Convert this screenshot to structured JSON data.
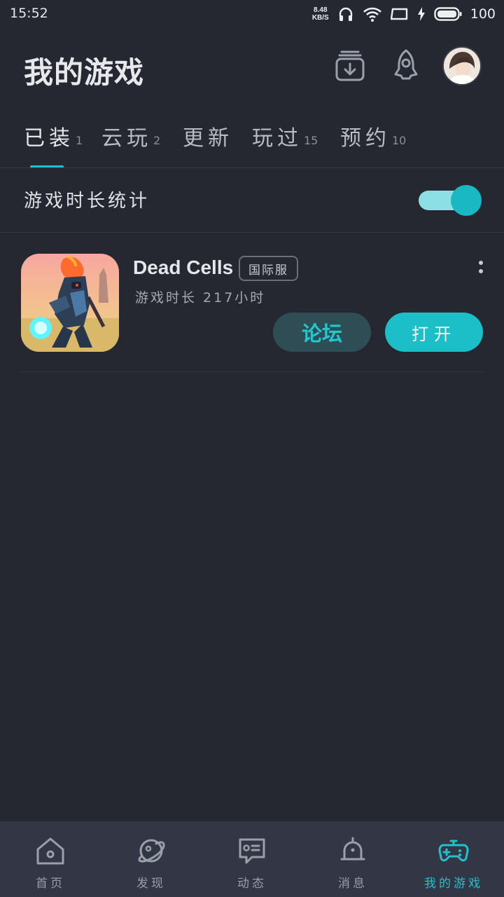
{
  "status_bar": {
    "time": "15:52",
    "net_speed_value": "8.48",
    "net_speed_unit": "KB/S",
    "battery_percent": "100",
    "icons": [
      "headphones-icon",
      "wifi-icon",
      "screen-icon",
      "charging-icon",
      "battery-icon"
    ]
  },
  "header": {
    "title": "我的游戏",
    "icons": [
      "download-icon",
      "rocket-icon",
      "avatar"
    ]
  },
  "tabs": [
    {
      "label": "已装",
      "count": "1",
      "active": true
    },
    {
      "label": "云玩",
      "count": "2",
      "active": false
    },
    {
      "label": "更新",
      "count": "",
      "active": false
    },
    {
      "label": "玩过",
      "count": "15",
      "active": false
    },
    {
      "label": "预约",
      "count": "10",
      "active": false
    }
  ],
  "stats": {
    "label": "游戏时长统计",
    "enabled": true
  },
  "games": [
    {
      "name": "Dead Cells",
      "server_badge": "国际服",
      "play_time": "游戏时长 217小时",
      "forum_label": "论坛",
      "open_label": "打开"
    }
  ],
  "bottom_nav": [
    {
      "label": "首页",
      "icon": "home-icon",
      "active": false
    },
    {
      "label": "发现",
      "icon": "planet-icon",
      "active": false
    },
    {
      "label": "动态",
      "icon": "chat-bubble-icon",
      "active": false
    },
    {
      "label": "消息",
      "icon": "bell-icon",
      "active": false
    },
    {
      "label": "我的游戏",
      "icon": "gamepad-icon",
      "active": true
    }
  ],
  "colors": {
    "background": "#252731",
    "accent": "#1ec2cc",
    "nav_background": "#333644"
  }
}
